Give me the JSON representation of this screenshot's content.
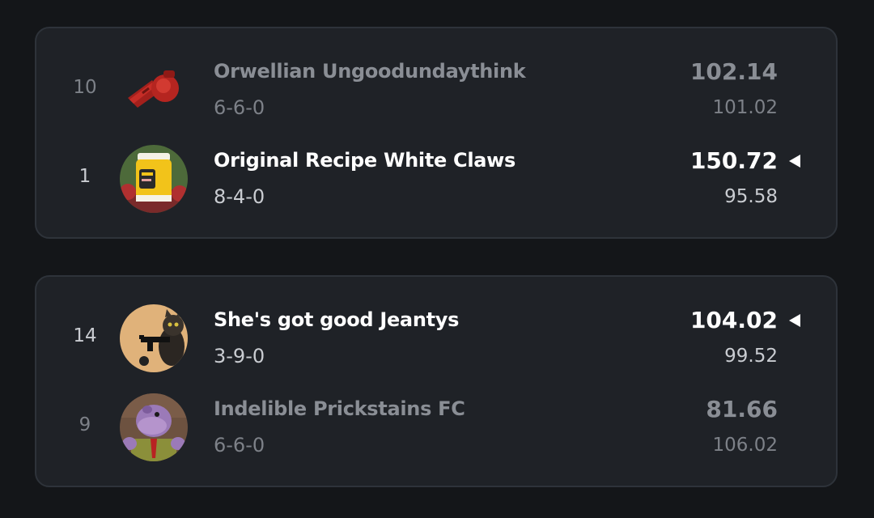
{
  "colors": {
    "background": "#141619",
    "card": "#1f2227",
    "card_border": "#2e333a",
    "winner_text": "#ffffff",
    "loser_text": "#8a8e95"
  },
  "matchups": [
    {
      "teams": [
        {
          "seed": "10",
          "name": "Orwellian Ungoodundaythink",
          "record": "6-6-0",
          "score": "102.14",
          "projected": "101.02",
          "winner": false,
          "avatar_icon": "red-whistle-icon"
        },
        {
          "seed": "1",
          "name": "Original Recipe White Claws",
          "record": "8-4-0",
          "score": "150.72",
          "projected": "95.58",
          "winner": true,
          "avatar_icon": "mayo-jar-avatar"
        }
      ]
    },
    {
      "teams": [
        {
          "seed": "14",
          "name": "She's got good Jeantys",
          "record": "3-9-0",
          "score": "104.02",
          "projected": "99.52",
          "winner": true,
          "avatar_icon": "cat-with-gun-avatar"
        },
        {
          "seed": "9",
          "name": "Indelible Prickstains FC",
          "record": "6-6-0",
          "score": "81.66",
          "projected": "106.02",
          "winner": false,
          "avatar_icon": "cartoon-hippo-avatar"
        }
      ]
    }
  ]
}
